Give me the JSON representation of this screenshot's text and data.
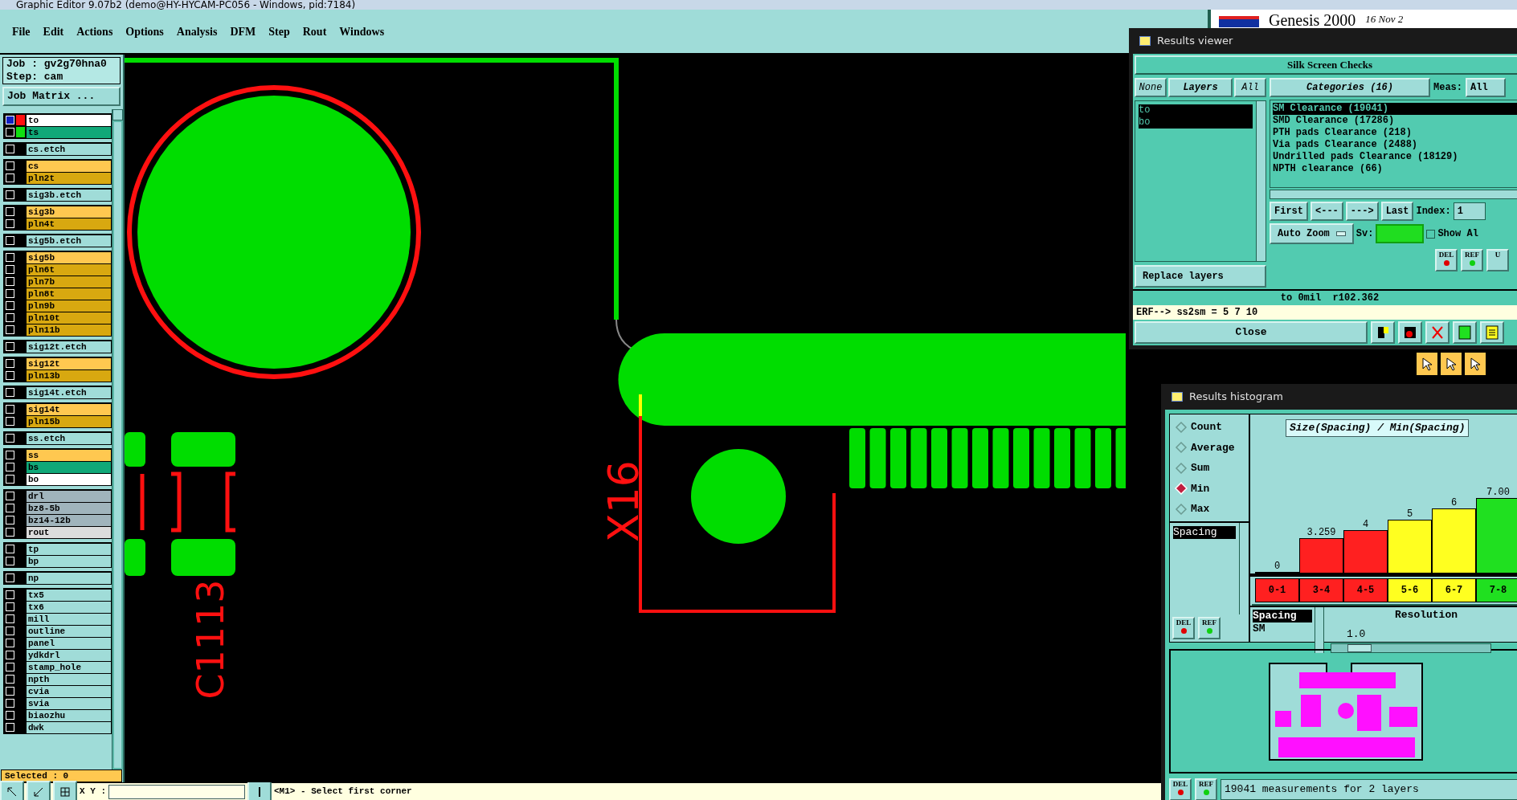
{
  "window": {
    "title": "Graphic Editor 9.07b2 (demo@HY-HYCAM-PC056 - Windows, pid:7184)"
  },
  "menu": [
    "File",
    "Edit",
    "Actions",
    "Options",
    "Analysis",
    "DFM",
    "Step",
    "Rout",
    "Windows"
  ],
  "brand": {
    "name": "Genesis 2000",
    "date": "16 Nov 2"
  },
  "job": {
    "job": "Job : gv2g70hna0",
    "step": "Step: cam",
    "matrix_button": "Job Matrix ..."
  },
  "layer_groups": [
    [
      {
        "name": "to",
        "color": "#ffffff",
        "swatch": {
          "color": "#ff1010"
        },
        "checked": true
      },
      {
        "name": "ts",
        "color": "#10a878",
        "swatch": {
          "color": "#10e010"
        },
        "checked": false
      }
    ],
    [
      {
        "name": "cs.etch",
        "color": "#a0dcd8",
        "checked": false
      }
    ],
    [
      {
        "name": "cs",
        "color": "#ffc850",
        "checked": false
      },
      {
        "name": "pln2t",
        "color": "#d8a810",
        "checked": false
      }
    ],
    [
      {
        "name": "sig3b.etch",
        "color": "#a0dcd8",
        "checked": false
      }
    ],
    [
      {
        "name": "sig3b",
        "color": "#ffc850",
        "checked": false
      },
      {
        "name": "pln4t",
        "color": "#d8a810",
        "checked": false
      }
    ],
    [
      {
        "name": "sig5b.etch",
        "color": "#a0dcd8",
        "checked": false
      }
    ],
    [
      {
        "name": "sig5b",
        "color": "#ffc850",
        "checked": false
      },
      {
        "name": "pln6t",
        "color": "#d8a810",
        "checked": false
      },
      {
        "name": "pln7b",
        "color": "#d8a810",
        "checked": false
      },
      {
        "name": "pln8t",
        "color": "#d8a810",
        "checked": false
      },
      {
        "name": "pln9b",
        "color": "#d8a810",
        "checked": false
      },
      {
        "name": "pln10t",
        "color": "#d8a810",
        "checked": false
      },
      {
        "name": "pln11b",
        "color": "#d8a810",
        "checked": false
      }
    ],
    [
      {
        "name": "sig12t.etch",
        "color": "#a0dcd8",
        "checked": false
      }
    ],
    [
      {
        "name": "sig12t",
        "color": "#ffc850",
        "checked": false
      },
      {
        "name": "pln13b",
        "color": "#d8a810",
        "checked": false
      }
    ],
    [
      {
        "name": "sig14t.etch",
        "color": "#a0dcd8",
        "checked": false
      }
    ],
    [
      {
        "name": "sig14t",
        "color": "#ffc850",
        "checked": false
      },
      {
        "name": "pln15b",
        "color": "#d8a810",
        "checked": false
      }
    ],
    [
      {
        "name": "ss.etch",
        "color": "#a0dcd8",
        "checked": false
      }
    ],
    [
      {
        "name": "ss",
        "color": "#ffc850",
        "checked": false
      },
      {
        "name": "bs",
        "color": "#10a878",
        "checked": false
      },
      {
        "name": "bo",
        "color": "#ffffff",
        "checked": false
      }
    ],
    [
      {
        "name": "drl",
        "color": "#a0b4bc",
        "checked": false
      },
      {
        "name": "bz8-5b",
        "color": "#a0b4bc",
        "checked": false
      },
      {
        "name": "bz14-12b",
        "color": "#a0b4bc",
        "checked": false
      },
      {
        "name": "rout",
        "color": "#dcdcdc",
        "checked": false
      }
    ],
    [
      {
        "name": "tp",
        "color": "#a0dcd8",
        "checked": false
      },
      {
        "name": "bp",
        "color": "#a0dcd8",
        "checked": false
      }
    ],
    [
      {
        "name": "np",
        "color": "#a0dcd8",
        "checked": false
      }
    ],
    [
      {
        "name": "tx5",
        "color": "#a0dcd8",
        "checked": false
      },
      {
        "name": "tx6",
        "color": "#a0dcd8",
        "checked": false
      },
      {
        "name": "mill",
        "color": "#a0dcd8",
        "checked": false
      },
      {
        "name": "outline",
        "color": "#a0dcd8",
        "checked": false
      },
      {
        "name": "panel",
        "color": "#a0dcd8",
        "checked": false
      },
      {
        "name": "ydkdrl",
        "color": "#a0dcd8",
        "checked": false
      },
      {
        "name": "stamp_hole",
        "color": "#a0dcd8",
        "checked": false
      },
      {
        "name": "npth",
        "color": "#a0dcd8",
        "checked": false
      },
      {
        "name": "cvia",
        "color": "#a0dcd8",
        "checked": false
      },
      {
        "name": "svia",
        "color": "#a0dcd8",
        "checked": false
      },
      {
        "name": "biaozhu",
        "color": "#a0dcd8",
        "checked": false
      },
      {
        "name": "dwk",
        "color": "#a0dcd8",
        "checked": false
      }
    ]
  ],
  "selected_count": "Selected : 0",
  "canvas_labels": [
    "X16",
    "C1113"
  ],
  "results_viewer": {
    "title": "Results viewer",
    "heading": "Silk Screen Checks",
    "layer_buttons": [
      "None",
      "Layers",
      "All"
    ],
    "layers": [
      {
        "name": "to",
        "selected": true
      },
      {
        "name": "bo",
        "selected": true
      }
    ],
    "categories_button": "Categories (16)",
    "meas_label": "Meas:",
    "meas_value": "All",
    "categories": [
      {
        "name": "SM Clearance (19041)",
        "selected": true
      },
      {
        "name": "SMD Clearance (17286)",
        "selected": false
      },
      {
        "name": "PTH pads Clearance (218)",
        "selected": false
      },
      {
        "name": "Via pads Clearance (2488)",
        "selected": false
      },
      {
        "name": "Undrilled pads Clearance (18129)",
        "selected": false
      },
      {
        "name": "NPTH clearance (66)",
        "selected": false
      }
    ],
    "nav": [
      "First",
      "<---",
      "--->",
      "Last"
    ],
    "index_label": "Index:",
    "index_value": "1",
    "zoom_mode": "Auto Zoom",
    "sv_label": "Sv:",
    "show_all": {
      "label": "Show Al",
      "checked": false
    },
    "small_buttons": [
      "DEL",
      "REF",
      "U"
    ],
    "replace": "Replace layers",
    "status": "to 0mil  r102.362",
    "erf": "ERF--> ss2sm = 5 7 10",
    "close": "Close"
  },
  "results_histogram": {
    "title": "Results histogram",
    "modes": [
      {
        "label": "Count",
        "selected": false
      },
      {
        "label": "Average",
        "selected": false
      },
      {
        "label": "Sum",
        "selected": false
      },
      {
        "label": "Min",
        "selected": true
      },
      {
        "label": "Max",
        "selected": false
      }
    ],
    "attributes": [
      {
        "name": "Spacing",
        "selected": true
      }
    ],
    "chart_data": {
      "type": "bar",
      "title": "Size(Spacing) / Min(Spacing)",
      "categories": [
        "0-1",
        "3-4",
        "4-5",
        "5-6",
        "6-7",
        "7-8"
      ],
      "values": [
        0,
        3.259,
        4,
        5,
        6,
        7.0
      ],
      "value_labels": [
        "0",
        "3.259",
        "4",
        "5",
        "6",
        "7.00"
      ]
    },
    "bin_colors": [
      {
        "color": "#ff2020"
      },
      {
        "color": "#ff2020"
      },
      {
        "color": "#ff2020"
      },
      {
        "color": "#ffff20"
      },
      {
        "color": "#ffff20"
      },
      {
        "color": "#20e020"
      }
    ],
    "sub_list": [
      {
        "name": "Spacing",
        "selected": true
      },
      {
        "name": "SM",
        "selected": false
      }
    ],
    "resolution_label": "Resolution",
    "resolution_value": "1.0",
    "resolution": {
      "level": 0.1
    },
    "buttons": [
      "DEL",
      "REF"
    ],
    "bottom_buttons": [
      "DEL",
      "REF"
    ],
    "summary": "19041 measurements for 2 layers"
  },
  "bottom_bar": {
    "xy_label": "X Y :",
    "prompt": "<M1> - Select first corner"
  }
}
